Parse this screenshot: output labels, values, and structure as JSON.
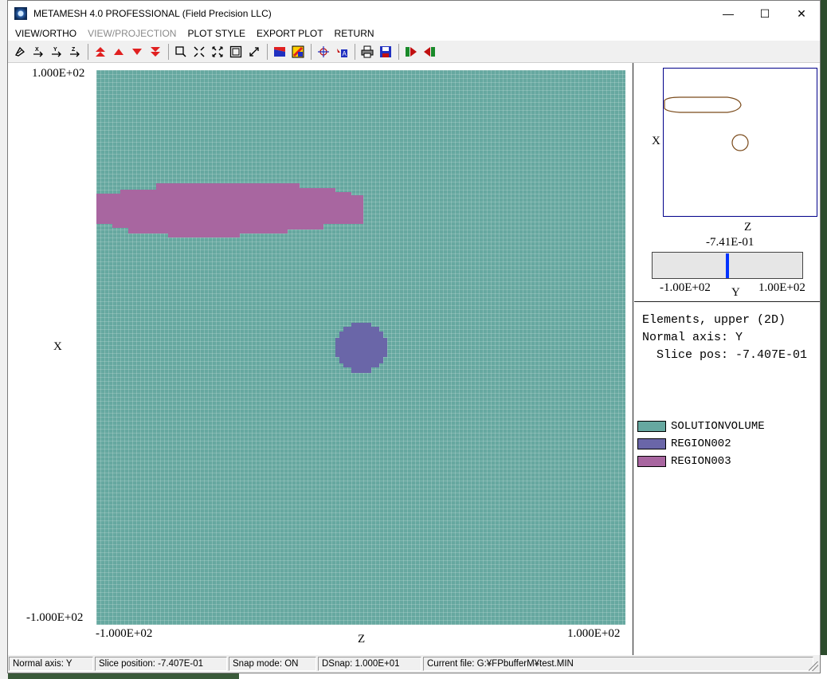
{
  "window": {
    "title": "METAMESH 4.0 PROFESSIONAL (Field Precision LLC)",
    "minimize": "—",
    "maximize": "☐",
    "close": "✕"
  },
  "menu": [
    {
      "label": "VIEW/ORTHO",
      "enabled": true
    },
    {
      "label": "VIEW/PROJECTION",
      "enabled": false
    },
    {
      "label": "PLOT STYLE",
      "enabled": true
    },
    {
      "label": "EXPORT PLOT",
      "enabled": true
    },
    {
      "label": "RETURN",
      "enabled": true
    }
  ],
  "toolbar": {
    "icons": [
      "rotate-view-icon",
      "x-axis-icon",
      "y-axis-icon",
      "z-axis-icon",
      "slice-top-icon",
      "slice-up-icon",
      "slice-down-icon",
      "slice-bottom-icon",
      "zoom-window-icon",
      "zoom-in-icon",
      "zoom-out-icon",
      "zoom-fit-icon",
      "pan-icon",
      "color-regions-icon",
      "color-fill-icon",
      "crosshair-icon",
      "region-info-icon",
      "print-icon",
      "save-icon",
      "play-forward-icon",
      "play-back-icon"
    ]
  },
  "plot": {
    "x_max": "1.000E+02",
    "x_min": "-1.000E+02",
    "z_min": "-1.000E+02",
    "z_max": "1.000E+02",
    "vertical_axis": "X",
    "horizontal_axis": "Z"
  },
  "mini_view": {
    "vertical_axis": "X",
    "horizontal_axis": "Z"
  },
  "slider": {
    "value": "-7.41E-01",
    "min": "-1.00E+02",
    "max": "1.00E+02",
    "axis": "Y",
    "fraction": 0.496
  },
  "info": {
    "line1": "Elements, upper (2D)",
    "line2": "Normal axis: Y",
    "line3": "  Slice pos: -7.407E-01"
  },
  "legend": [
    {
      "name": "SOLUTIONVOLUME",
      "color": "#66a8a0"
    },
    {
      "name": "REGION002",
      "color": "#6a66a8"
    },
    {
      "name": "REGION003",
      "color": "#a866a0"
    }
  ],
  "status": {
    "normal_axis": "Normal axis: Y",
    "slice_position": "Slice position:  -7.407E-01",
    "snap_mode": "Snap mode: ON",
    "dsnap": "DSnap:   1.000E+01",
    "current_file": "Current file: G:¥FPbufferM¥test.MIN"
  }
}
